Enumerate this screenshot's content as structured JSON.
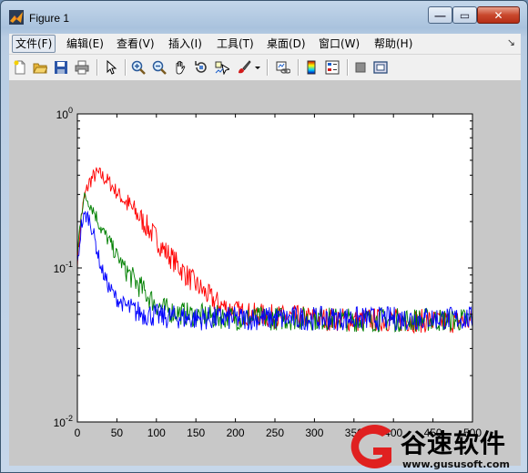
{
  "window": {
    "title": "Figure 1",
    "controls": {
      "minimize": "—",
      "maximize": "▭",
      "close": "✕"
    }
  },
  "menu": {
    "items": [
      {
        "name": "menu-file",
        "label": "文件(F)"
      },
      {
        "name": "menu-edit",
        "label": "编辑(E)"
      },
      {
        "name": "menu-view",
        "label": "查看(V)"
      },
      {
        "name": "menu-insert",
        "label": "插入(I)"
      },
      {
        "name": "menu-tools",
        "label": "工具(T)"
      },
      {
        "name": "menu-desktop",
        "label": "桌面(D)"
      },
      {
        "name": "menu-window",
        "label": "窗口(W)"
      },
      {
        "name": "menu-help",
        "label": "帮助(H)"
      }
    ],
    "overflow_arrow": "↘"
  },
  "toolbar": {
    "icons": [
      "new-figure-icon",
      "open-file-icon",
      "save-icon",
      "print-icon",
      "edit-plot-arrow-icon",
      "zoom-in-icon",
      "zoom-out-icon",
      "pan-hand-icon",
      "rotate-3d-icon",
      "data-cursor-icon",
      "brush-icon",
      "brush-dropdown-icon",
      "link-plot-icon",
      "colorbar-icon",
      "legend-icon",
      "hide-plot-tools-icon",
      "show-plot-tools-icon"
    ]
  },
  "chart_data": {
    "type": "line",
    "title": "",
    "xlabel": "",
    "ylabel": "",
    "xlim": [
      0,
      500
    ],
    "ylim": [
      0.01,
      1
    ],
    "yscale": "log",
    "grid": false,
    "x_ticks": [
      0,
      50,
      100,
      150,
      200,
      250,
      300,
      350,
      400,
      450,
      500
    ],
    "x_tick_labels": [
      "0",
      "50",
      "100",
      "150",
      "200",
      "250",
      "300",
      "350",
      "400",
      "450",
      "500"
    ],
    "y_tick_labels": [
      {
        "base": "10",
        "exp": "0",
        "value": 1
      },
      {
        "base": "10",
        "exp": "-1",
        "value": 0.1
      },
      {
        "base": "10",
        "exp": "-2",
        "value": 0.01
      }
    ],
    "series": [
      {
        "color": "#ff0000",
        "x": [
          0,
          5,
          10,
          15,
          20,
          25,
          30,
          40,
          50,
          60,
          70,
          80,
          90,
          100,
          110,
          120,
          130,
          140,
          150,
          160,
          170,
          180,
          190,
          200,
          220,
          240,
          260,
          280,
          300,
          350,
          400,
          450,
          500
        ],
        "y": [
          0.11,
          0.22,
          0.3,
          0.36,
          0.39,
          0.41,
          0.4,
          0.36,
          0.31,
          0.27,
          0.24,
          0.21,
          0.18,
          0.155,
          0.13,
          0.115,
          0.1,
          0.088,
          0.078,
          0.07,
          0.063,
          0.058,
          0.055,
          0.052,
          0.05,
          0.049,
          0.048,
          0.048,
          0.047,
          0.046,
          0.046,
          0.045,
          0.045
        ]
      },
      {
        "color": "#008000",
        "x": [
          0,
          5,
          10,
          15,
          20,
          25,
          30,
          40,
          50,
          60,
          70,
          80,
          90,
          100,
          110,
          120,
          130,
          140,
          150,
          160,
          170,
          180,
          190,
          200,
          220,
          240,
          260,
          280,
          300,
          350,
          400,
          450,
          500
        ],
        "y": [
          0.12,
          0.24,
          0.29,
          0.27,
          0.24,
          0.21,
          0.18,
          0.15,
          0.12,
          0.1,
          0.085,
          0.075,
          0.065,
          0.058,
          0.054,
          0.052,
          0.051,
          0.05,
          0.049,
          0.049,
          0.048,
          0.048,
          0.048,
          0.047,
          0.047,
          0.047,
          0.047,
          0.047,
          0.047,
          0.046,
          0.046,
          0.046,
          0.046
        ]
      },
      {
        "color": "#0000ff",
        "x": [
          0,
          5,
          10,
          15,
          20,
          25,
          30,
          40,
          50,
          60,
          70,
          80,
          90,
          100,
          110,
          120,
          130,
          140,
          150,
          160,
          170,
          180,
          190,
          200,
          220,
          240,
          260,
          280,
          300,
          350,
          400,
          450,
          500
        ],
        "y": [
          0.1,
          0.19,
          0.22,
          0.21,
          0.17,
          0.13,
          0.1,
          0.075,
          0.063,
          0.057,
          0.053,
          0.051,
          0.05,
          0.049,
          0.048,
          0.048,
          0.048,
          0.047,
          0.047,
          0.047,
          0.047,
          0.047,
          0.047,
          0.047,
          0.047,
          0.047,
          0.047,
          0.047,
          0.047,
          0.047,
          0.047,
          0.047,
          0.047
        ]
      }
    ]
  },
  "watermark": {
    "text": "谷速软件",
    "url": "www.gususoft.com"
  }
}
